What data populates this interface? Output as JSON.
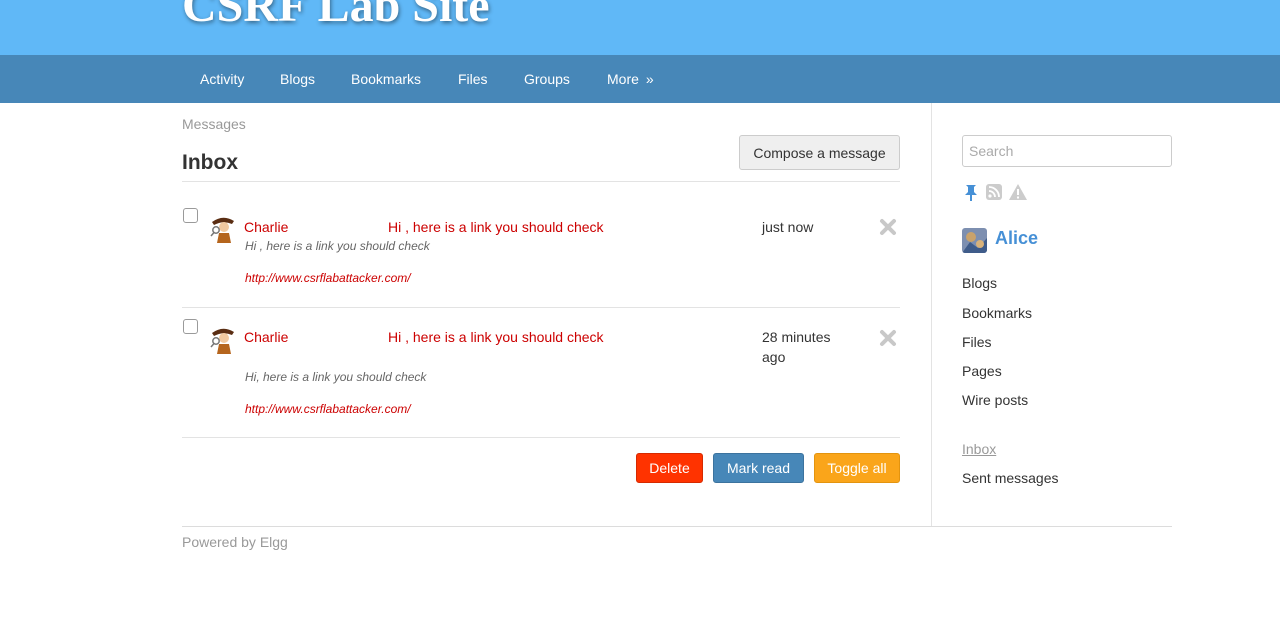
{
  "site": {
    "title": "CSRF Lab Site"
  },
  "nav": {
    "items": [
      "Activity",
      "Blogs",
      "Bookmarks",
      "Files",
      "Groups",
      "More"
    ],
    "more_arrow": "»"
  },
  "breadcrumb": "Messages",
  "page": {
    "title": "Inbox",
    "compose_label": "Compose a message"
  },
  "messages": [
    {
      "from": "Charlie",
      "subject": "Hi , here is a link you should check",
      "time": "just now",
      "excerpt": "Hi , here is a link you should check",
      "link": "http://www.csrflabattacker.com/"
    },
    {
      "from": "Charlie",
      "subject": "Hi , here is a link you should check",
      "time": "28 minutes ago",
      "excerpt": "Hi, here is a link you should check",
      "link": "http://www.csrflabattacker.com/"
    }
  ],
  "actions": {
    "delete": "Delete",
    "mark_read": "Mark read",
    "toggle_all": "Toggle all"
  },
  "footer": "Powered by Elgg",
  "sidebar": {
    "search_placeholder": "Search",
    "icons": [
      "pin-icon",
      "rss-icon",
      "warning-icon"
    ],
    "owner": "Alice",
    "links": [
      "Blogs",
      "Bookmarks",
      "Files",
      "Pages",
      "Wire posts"
    ],
    "inbox": "Inbox",
    "sent": "Sent messages"
  },
  "colors": {
    "header": "#60b8f7",
    "nav": "#4787b8",
    "accent_red": "#cc0000",
    "delete": "#ff3300",
    "mark_read": "#4787b8",
    "toggle": "#faa51a",
    "owner_link": "#4690d6"
  }
}
